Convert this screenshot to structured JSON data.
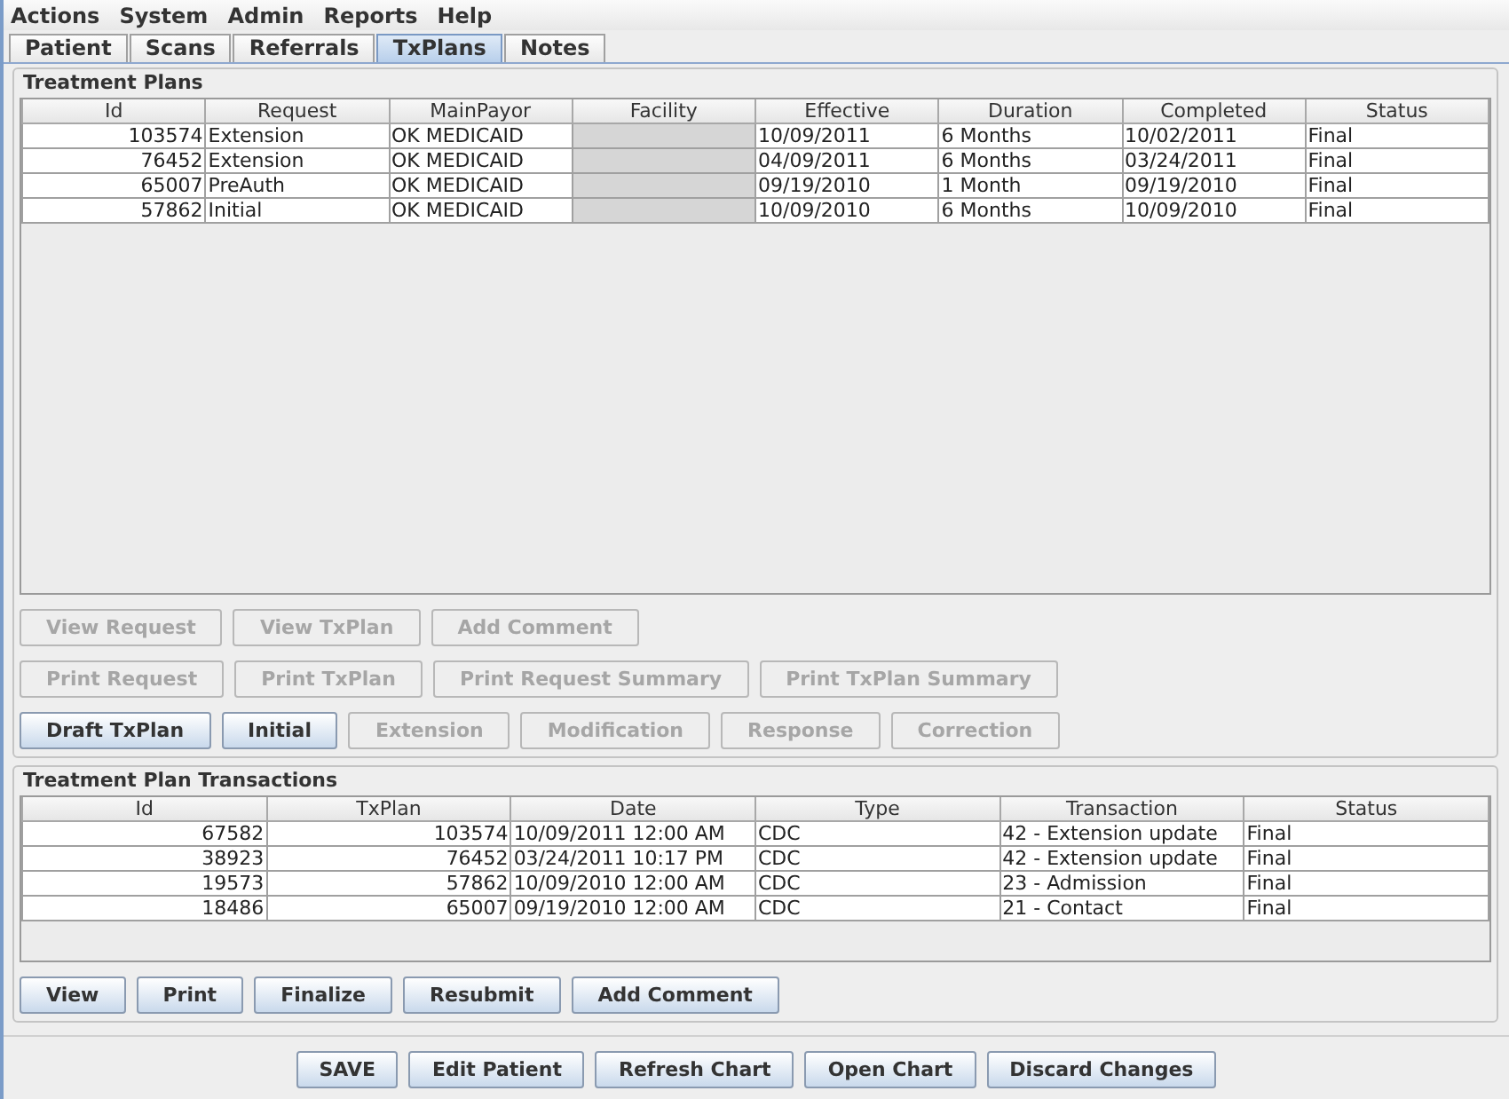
{
  "menu": [
    {
      "label": "Actions"
    },
    {
      "label": "System"
    },
    {
      "label": "Admin"
    },
    {
      "label": "Reports"
    },
    {
      "label": "Help"
    }
  ],
  "tabs": [
    {
      "label": "Patient",
      "selected": false
    },
    {
      "label": "Scans",
      "selected": false
    },
    {
      "label": "Referrals",
      "selected": false
    },
    {
      "label": "TxPlans",
      "selected": true
    },
    {
      "label": "Notes",
      "selected": false
    }
  ],
  "treatment_plans": {
    "title": "Treatment Plans",
    "columns": [
      {
        "label": "Id"
      },
      {
        "label": "Request"
      },
      {
        "label": "MainPayor"
      },
      {
        "label": "Facility",
        "disabled": true
      },
      {
        "label": "Effective"
      },
      {
        "label": "Duration"
      },
      {
        "label": "Completed"
      },
      {
        "label": "Status"
      }
    ],
    "rows": [
      {
        "id": "103574",
        "request": "Extension",
        "main_payor": "OK MEDICAID",
        "effective": "10/09/2011",
        "duration": "6 Months",
        "completed": "10/02/2011",
        "status": "Final"
      },
      {
        "id": "76452",
        "request": "Extension",
        "main_payor": "OK MEDICAID",
        "effective": "04/09/2011",
        "duration": "6 Months",
        "completed": "03/24/2011",
        "status": "Final"
      },
      {
        "id": "65007",
        "request": "PreAuth",
        "main_payor": "OK MEDICAID",
        "effective": "09/19/2010",
        "duration": "1 Month",
        "completed": "09/19/2010",
        "status": "Final"
      },
      {
        "id": "57862",
        "request": "Initial",
        "main_payor": "OK MEDICAID",
        "effective": "10/09/2010",
        "duration": "6 Months",
        "completed": "10/09/2010",
        "status": "Final"
      }
    ],
    "button_rows": [
      [
        {
          "label": "View Request",
          "disabled": true
        },
        {
          "label": "View TxPlan",
          "disabled": true
        },
        {
          "label": "Add Comment",
          "disabled": true
        }
      ],
      [
        {
          "label": "Print Request",
          "disabled": true
        },
        {
          "label": "Print TxPlan",
          "disabled": true
        },
        {
          "label": "Print Request Summary",
          "disabled": true
        },
        {
          "label": "Print TxPlan Summary",
          "disabled": true
        }
      ],
      [
        {
          "label": "Draft TxPlan",
          "disabled": false
        },
        {
          "label": "Initial",
          "disabled": false
        },
        {
          "label": "Extension",
          "disabled": true
        },
        {
          "label": "Modification",
          "disabled": true
        },
        {
          "label": "Response",
          "disabled": true
        },
        {
          "label": "Correction",
          "disabled": true
        }
      ]
    ]
  },
  "transactions": {
    "title": "Treatment Plan Transactions",
    "columns": [
      "Id",
      "TxPlan",
      "Date",
      "Type",
      "Transaction",
      "Status"
    ],
    "rows": [
      {
        "id": "67582",
        "txplan": "103574",
        "date": "10/09/2011 12:00 AM",
        "type": "CDC",
        "transaction": "42 - Extension update",
        "status": "Final"
      },
      {
        "id": "38923",
        "txplan": "76452",
        "date": "03/24/2011 10:17 PM",
        "type": "CDC",
        "transaction": "42 - Extension update",
        "status": "Final"
      },
      {
        "id": "19573",
        "txplan": "57862",
        "date": "10/09/2010 12:00 AM",
        "type": "CDC",
        "transaction": "23 - Admission",
        "status": "Final"
      },
      {
        "id": "18486",
        "txplan": "65007",
        "date": "09/19/2010 12:00 AM",
        "type": "CDC",
        "transaction": "21 - Contact",
        "status": "Final"
      }
    ],
    "buttons": [
      {
        "label": "View",
        "disabled": false
      },
      {
        "label": "Print",
        "disabled": false
      },
      {
        "label": "Finalize",
        "disabled": false
      },
      {
        "label": "Resubmit",
        "disabled": false
      },
      {
        "label": "Add Comment",
        "disabled": false
      }
    ]
  },
  "footer_buttons": [
    {
      "label": "SAVE"
    },
    {
      "label": "Edit Patient"
    },
    {
      "label": "Refresh Chart"
    },
    {
      "label": "Open Chart"
    },
    {
      "label": "Discard Changes"
    }
  ]
}
